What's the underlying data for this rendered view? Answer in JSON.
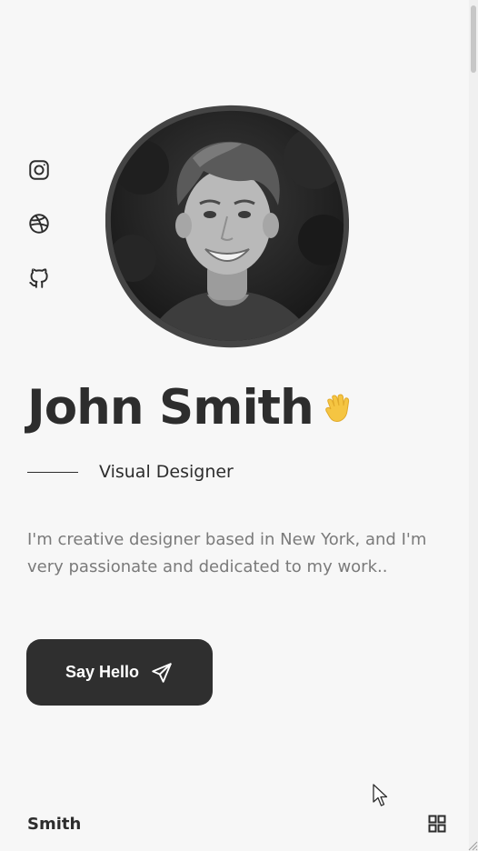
{
  "profile": {
    "name": "John Smith",
    "role": "Visual Designer",
    "description": "I'm creative designer based in New York, and I'm very passionate and dedicated to my work..",
    "wave_icon": "waving-hand-icon"
  },
  "social": [
    {
      "icon": "instagram-icon"
    },
    {
      "icon": "dribbble-icon"
    },
    {
      "icon": "github-icon"
    }
  ],
  "cta": {
    "label": "Say Hello",
    "icon": "send-icon"
  },
  "footer": {
    "brand": "Smith",
    "menu_icon": "grid-menu-icon"
  },
  "colors": {
    "background": "#f7f7f7",
    "text": "#2d2d2d",
    "muted": "#7a7a7a",
    "button": "#2f2f2f",
    "wave": "#f5c542"
  }
}
